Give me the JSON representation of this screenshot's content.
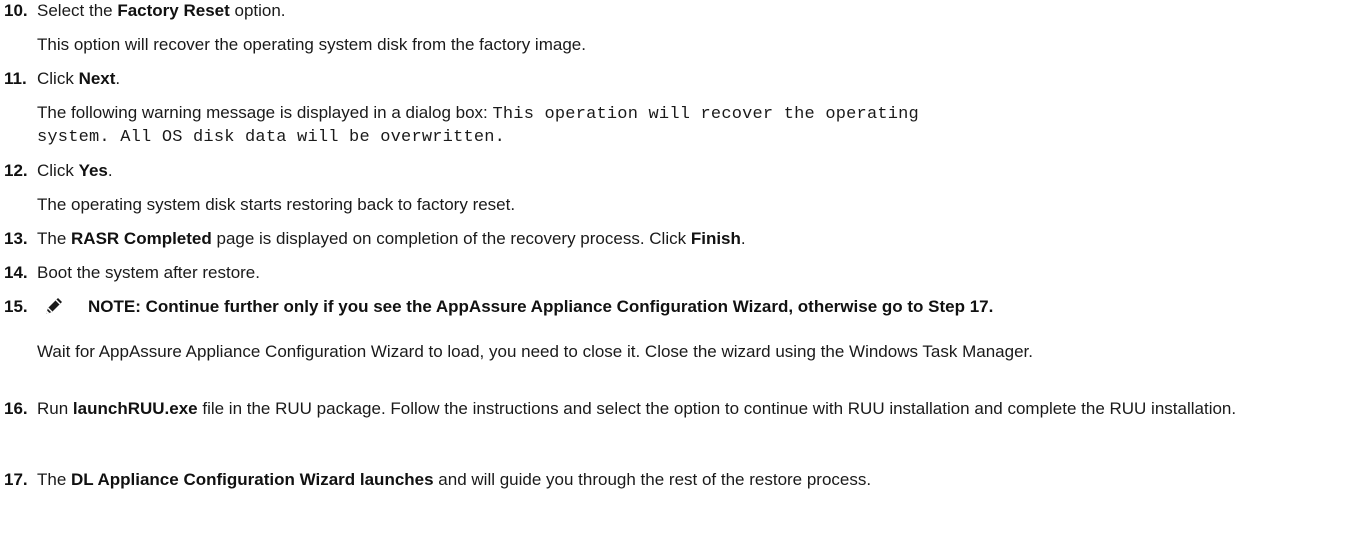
{
  "steps": [
    {
      "number": "10.",
      "line": {
        "pre": "Select the ",
        "bold": "Factory Reset",
        "post": " option."
      },
      "detail": "This option will recover the operating system disk from the factory image."
    },
    {
      "number": "11.",
      "line": {
        "pre": "Click ",
        "bold": "Next",
        "post": "."
      },
      "detail_pre": "The following warning message is displayed in a dialog box: ",
      "mono1": "This operation will recover the operating",
      "mono2": "system. All OS disk data will be overwritten."
    },
    {
      "number": "12.",
      "line": {
        "pre": "Click ",
        "bold": "Yes",
        "post": "."
      },
      "detail": "The operating system disk starts restoring back to factory reset."
    },
    {
      "number": "13.",
      "pre": "The ",
      "bold1": "RASR Completed",
      "mid": " page is displayed on completion of the recovery process. Click ",
      "bold2": "Finish",
      "post": "."
    },
    {
      "number": "14.",
      "text": "Boot the system after restore."
    },
    {
      "number": "15.",
      "note": "NOTE: Continue further only if you see the AppAssure Appliance Configuration Wizard, otherwise go to Step 17.",
      "note_icon": "pencil-note-icon",
      "detail": "Wait for AppAssure Appliance Configuration Wizard to load, you need to close it. Close the wizard using the Windows Task Manager."
    },
    {
      "number": "16.",
      "pre": "Run ",
      "bold": "launchRUU.exe",
      "post": " file in the RUU package. Follow the instructions and select the option to continue with RUU installation and complete the RUU installation."
    },
    {
      "number": "17.",
      "pre": "The ",
      "bold": "DL Appliance Configuration Wizard launches",
      "post": " and will guide you through the rest of the restore process."
    }
  ]
}
